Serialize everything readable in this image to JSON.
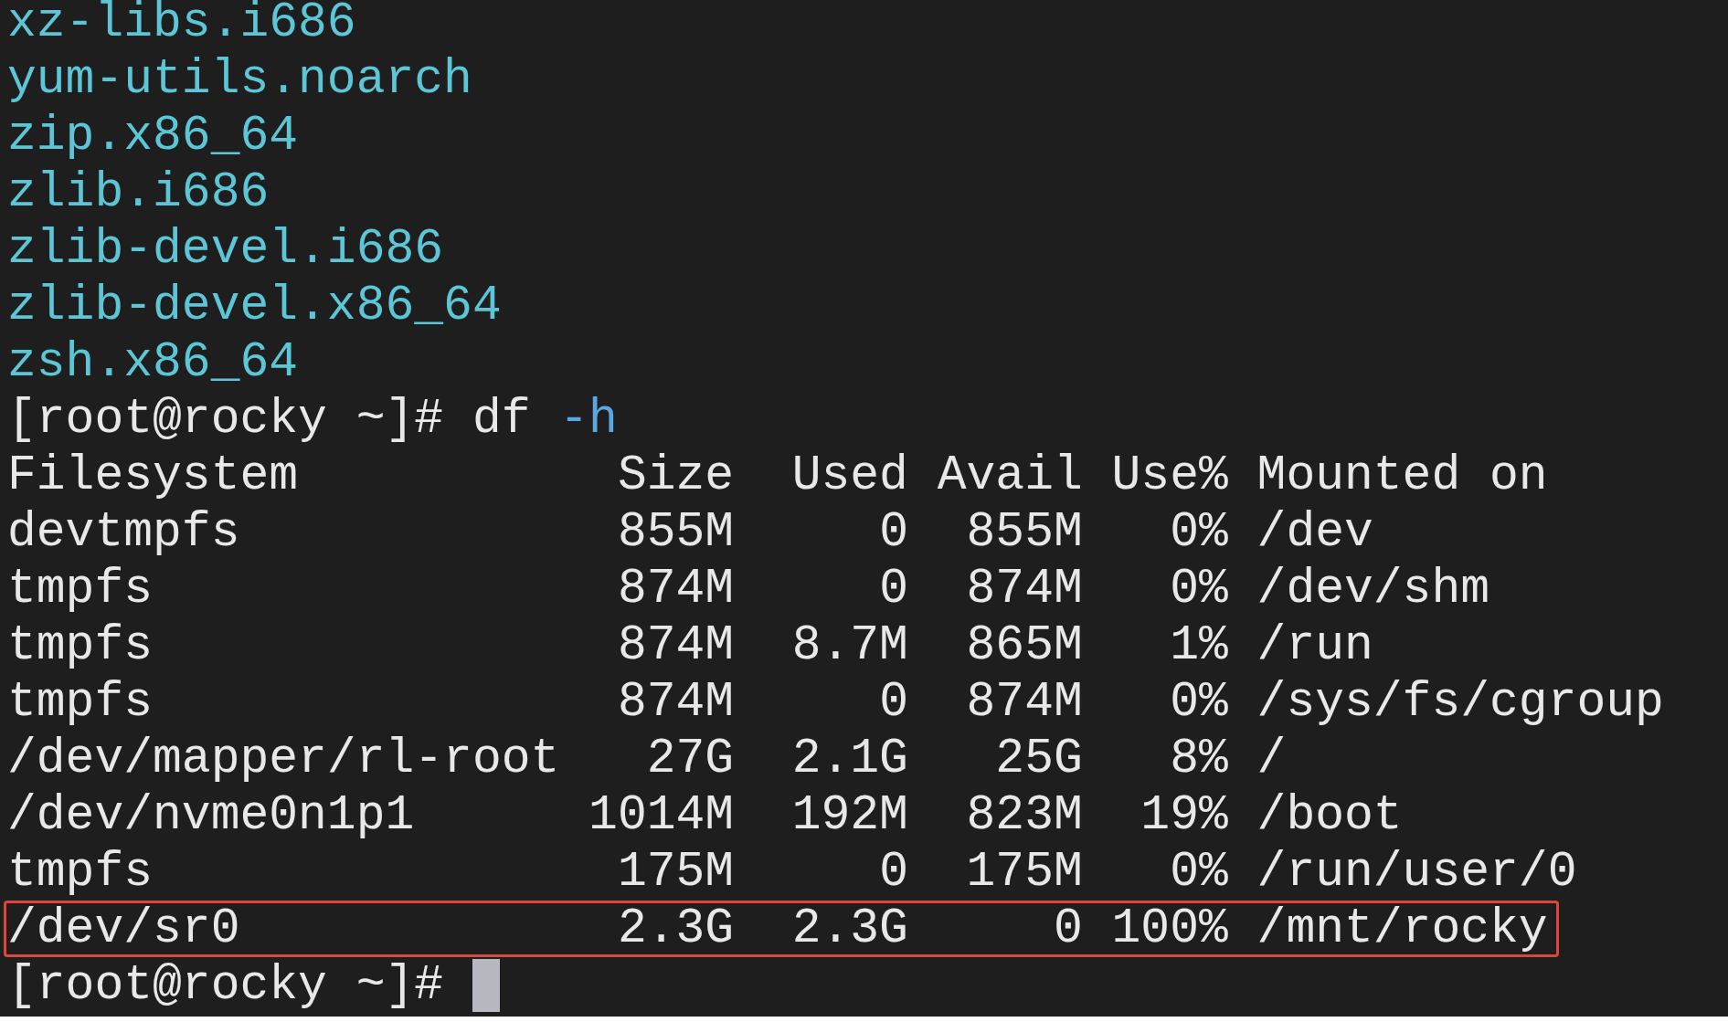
{
  "packages": [
    "xz-libs.i686",
    "yum-utils.noarch",
    "zip.x86_64",
    "zlib.i686",
    "zlib-devel.i686",
    "zlib-devel.x86_64",
    "zsh.x86_64"
  ],
  "command": {
    "prompt": "[root@rocky ~]#",
    "name": "df",
    "args": "-h"
  },
  "df": {
    "columns": [
      "Filesystem",
      "Size",
      "Used",
      "Avail",
      "Use%",
      "Mounted on"
    ],
    "rows": [
      {
        "cells": [
          "devtmpfs",
          "855M",
          "0",
          "855M",
          "0%",
          "/dev"
        ],
        "highlighted": false
      },
      {
        "cells": [
          "tmpfs",
          "874M",
          "0",
          "874M",
          "0%",
          "/dev/shm"
        ],
        "highlighted": false
      },
      {
        "cells": [
          "tmpfs",
          "874M",
          "8.7M",
          "865M",
          "1%",
          "/run"
        ],
        "highlighted": false
      },
      {
        "cells": [
          "tmpfs",
          "874M",
          "0",
          "874M",
          "0%",
          "/sys/fs/cgroup"
        ],
        "highlighted": false
      },
      {
        "cells": [
          "/dev/mapper/rl-root",
          "27G",
          "2.1G",
          "25G",
          "8%",
          "/"
        ],
        "highlighted": false
      },
      {
        "cells": [
          "/dev/nvme0n1p1",
          "1014M",
          "192M",
          "823M",
          "19%",
          "/boot"
        ],
        "highlighted": false
      },
      {
        "cells": [
          "tmpfs",
          "175M",
          "0",
          "175M",
          "0%",
          "/run/user/0"
        ],
        "highlighted": false
      },
      {
        "cells": [
          "/dev/sr0",
          "2.3G",
          "2.3G",
          "0",
          "100%",
          "/mnt/rocky"
        ],
        "highlighted": true
      }
    ]
  },
  "final_prompt": {
    "prompt": "[root@rocky ~]#",
    "cursor": true
  }
}
